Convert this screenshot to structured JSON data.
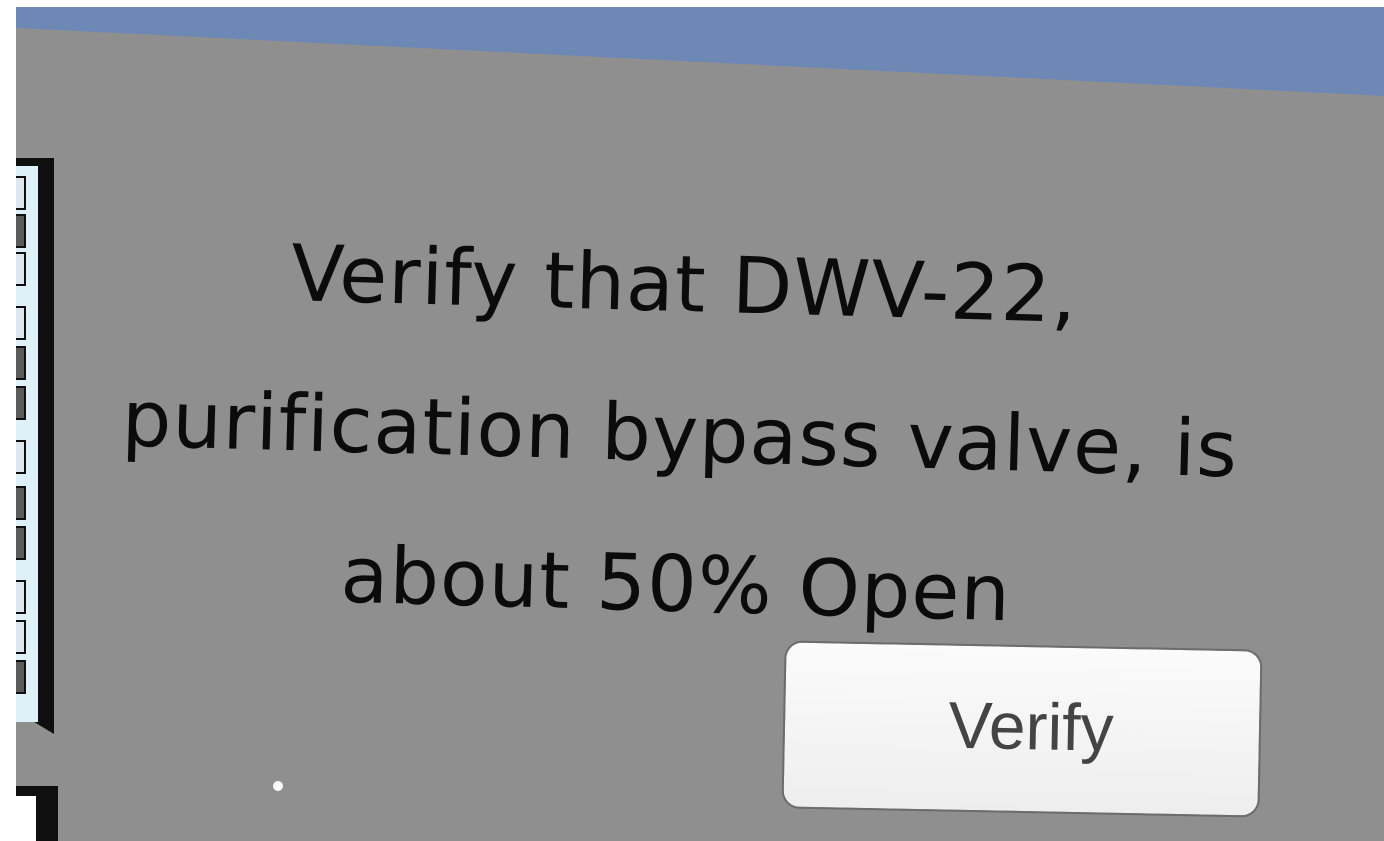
{
  "prompt": {
    "line1": "Verify that DWV-22,",
    "line2": "purification bypass valve, is",
    "line3": "about 50% Open"
  },
  "buttons": {
    "verify_label": "Verify"
  },
  "colors": {
    "sky": "#6e88b5",
    "panel": "#8f8f8f",
    "text": "#0b0b0b",
    "button_bg": "#f5f5f5",
    "button_text": "#444444"
  },
  "icons": {
    "pointer": "cursor-dot-icon"
  }
}
